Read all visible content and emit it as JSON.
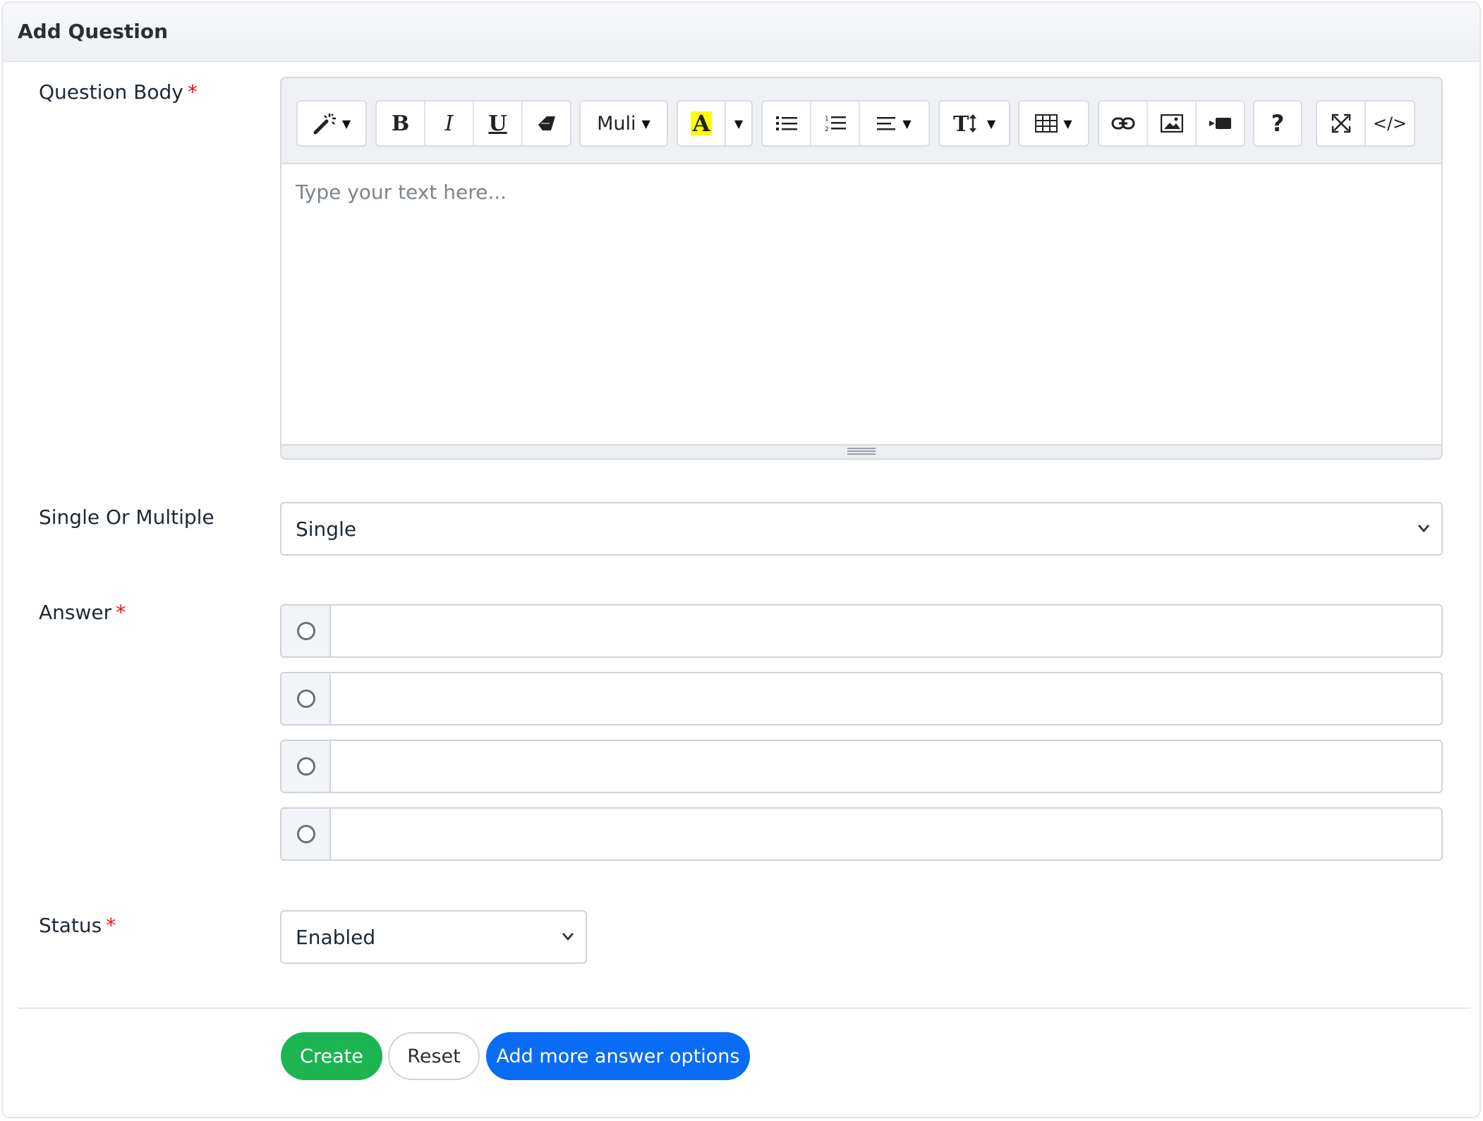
{
  "header": {
    "title": "Add Question"
  },
  "question_body": {
    "label": "Question Body",
    "required_mark": "*",
    "placeholder": "Type your text here...",
    "toolbar": {
      "font_name": "Muli",
      "help_label": "?",
      "code_label": "</>",
      "highlight_color": "#ffff00"
    }
  },
  "single_multiple": {
    "label": "Single Or Multiple",
    "value": "Single"
  },
  "answer": {
    "label": "Answer",
    "required_mark": "*",
    "rows": [
      "",
      "",
      "",
      ""
    ]
  },
  "status": {
    "label": "Status",
    "required_mark": "*",
    "value": "Enabled"
  },
  "actions": {
    "create": "Create",
    "reset": "Reset",
    "add_more": "Add more answer options"
  },
  "colors": {
    "create": "#1db454",
    "add_more": "#0a6cf5",
    "required": "#e0161b"
  }
}
